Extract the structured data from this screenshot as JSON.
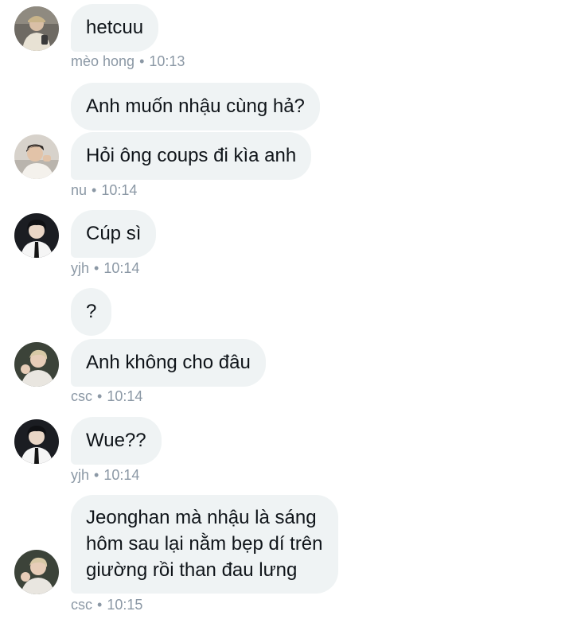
{
  "messages": [
    {
      "sender": "mèo hong",
      "time": "10:13",
      "bubbles": [
        "hetcuu"
      ]
    },
    {
      "sender": "nu",
      "time": "10:14",
      "bubbles": [
        "Anh muốn nhậu cùng hả?",
        "Hỏi ông coups đi kìa anh"
      ]
    },
    {
      "sender": "yjh",
      "time": "10:14",
      "bubbles": [
        "Cúp sì"
      ]
    },
    {
      "sender": "csc",
      "time": "10:14",
      "bubbles": [
        "?",
        "Anh không cho đâu"
      ]
    },
    {
      "sender": "yjh",
      "time": "10:14",
      "bubbles": [
        "Wue??"
      ]
    },
    {
      "sender": "csc",
      "time": "10:15",
      "bubbles": [
        [
          "Jeonghan mà nhậu là sáng",
          "hôm sau lại nằm bẹp dí trên",
          "giường rồi than đau lưng"
        ]
      ]
    }
  ],
  "separator": "•",
  "colors": {
    "bubble_bg": "#eff3f4",
    "text": "#0f1419",
    "meta_text": "#8b98a5"
  }
}
